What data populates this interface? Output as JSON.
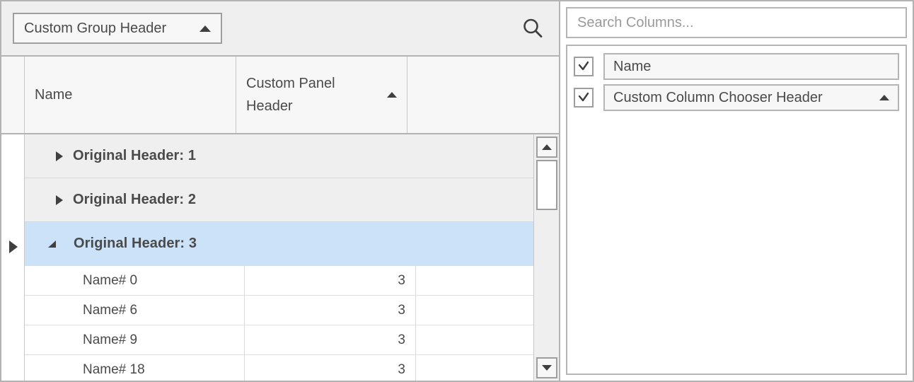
{
  "grid": {
    "group_panel": {
      "chip_label": "Custom Group Header",
      "chip_sort_icon": "sort-ascending-arrow-icon",
      "search_icon": "search-icon"
    },
    "columns": [
      {
        "key": "indicator",
        "header": ""
      },
      {
        "key": "name",
        "header": "Name"
      },
      {
        "key": "custom",
        "header": "Custom Panel Header",
        "sort_icon": "sort-ascending-arrow-icon"
      },
      {
        "key": "blank",
        "header": ""
      }
    ],
    "groups": [
      {
        "label": "Original Header: 1",
        "expanded": false,
        "selected": false
      },
      {
        "label": "Original Header: 2",
        "expanded": false,
        "selected": false
      },
      {
        "label": "Original Header: 3",
        "expanded": true,
        "selected": true
      }
    ],
    "rows": [
      {
        "name": "Name# 0",
        "value": "3",
        "blank": ""
      },
      {
        "name": "Name# 6",
        "value": "3",
        "blank": ""
      },
      {
        "name": "Name# 9",
        "value": "3",
        "blank": ""
      },
      {
        "name": "Name# 18",
        "value": "3",
        "blank": ""
      }
    ],
    "scrollbar": {
      "up_icon": "triangle-up-icon",
      "down_icon": "triangle-down-icon"
    }
  },
  "column_chooser": {
    "search": {
      "placeholder": "Search Columns...",
      "value": ""
    },
    "items": [
      {
        "label": "Name",
        "checked": true,
        "has_sort_icon": false
      },
      {
        "label": "Custom Column Chooser Header",
        "checked": true,
        "has_sort_icon": true,
        "sort_icon": "sort-ascending-arrow-icon"
      }
    ]
  },
  "colors": {
    "selection": "#cbe2f8",
    "group_row": "#efefef",
    "border": "#b3b3b3",
    "text": "#4a4a4a"
  }
}
